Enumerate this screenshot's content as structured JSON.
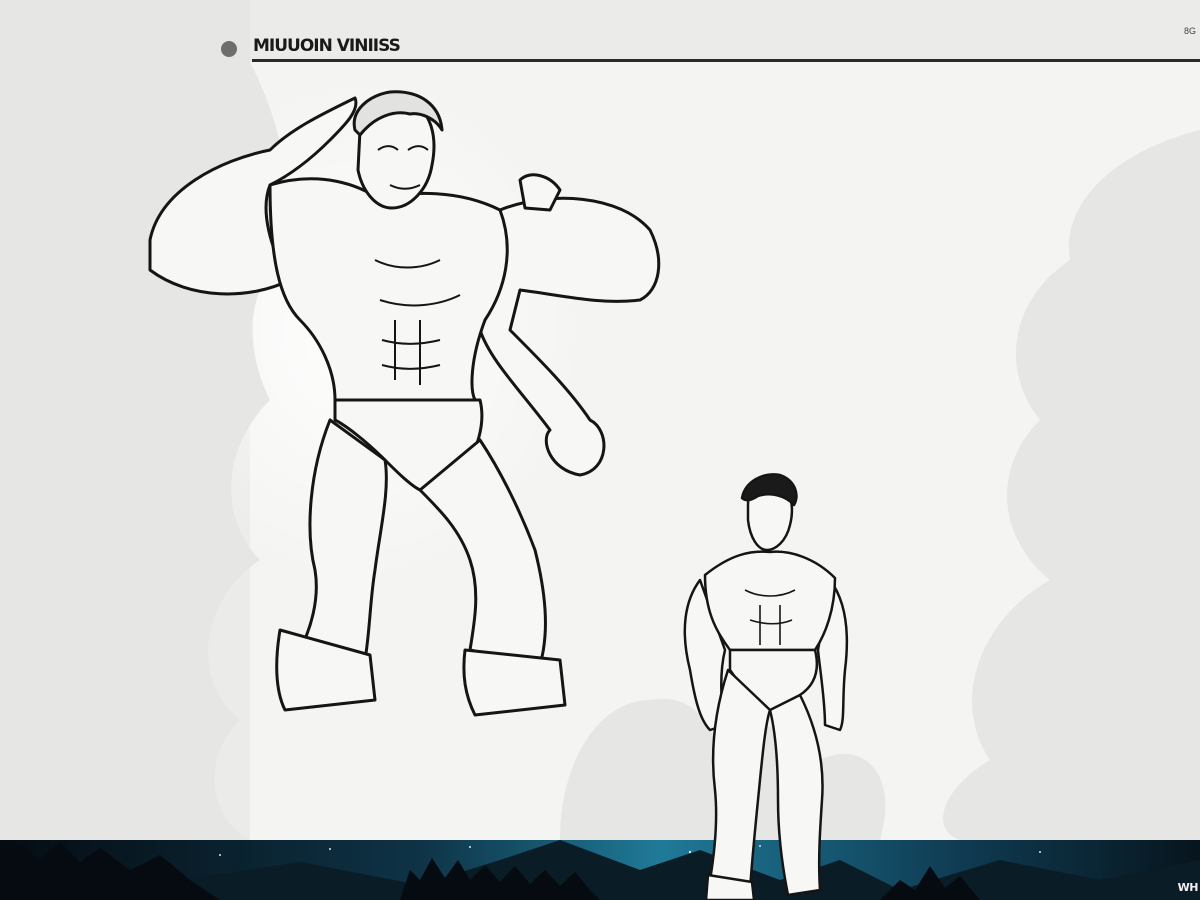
{
  "header": {
    "title": "MIUUOIN VINIISS",
    "corner": "8G"
  },
  "footer": {
    "label": "WH"
  },
  "colors": {
    "paper": "#ebebe9",
    "panel": "#f4f4f2",
    "ink": "#1a1a1a",
    "night_sky": "#0c2a3a",
    "aurora": "#2fa4c6"
  },
  "figures": [
    {
      "icon": "muscular-man-saluting-illustration"
    },
    {
      "icon": "muscular-man-standing-illustration"
    }
  ]
}
